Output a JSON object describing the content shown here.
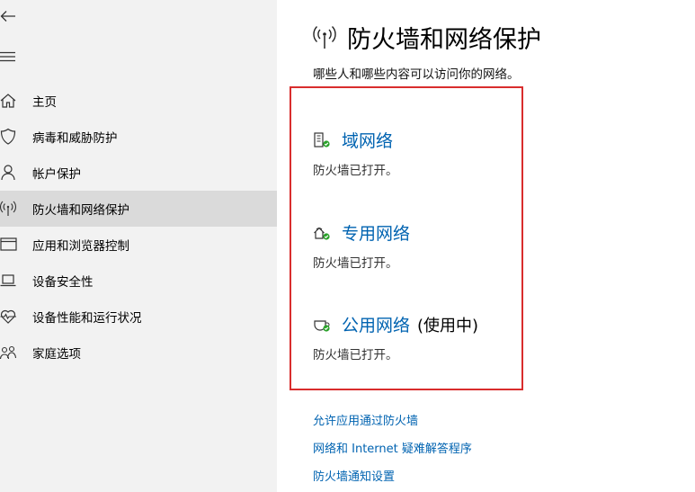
{
  "sidebar": {
    "items": [
      {
        "label": "主页",
        "icon": "home-icon"
      },
      {
        "label": "病毒和威胁防护",
        "icon": "shield-icon"
      },
      {
        "label": "帐户保护",
        "icon": "person-icon"
      },
      {
        "label": "防火墙和网络保护",
        "icon": "wifi-signal-icon",
        "selected": true
      },
      {
        "label": "应用和浏览器控制",
        "icon": "browser-window-icon"
      },
      {
        "label": "设备安全性",
        "icon": "laptop-icon"
      },
      {
        "label": "设备性能和运行状况",
        "icon": "heart-pulse-icon"
      },
      {
        "label": "家庭选项",
        "icon": "family-icon"
      }
    ]
  },
  "main": {
    "title": "防火墙和网络保护",
    "description": "哪些人和哪些内容可以访问你的网络。",
    "networks": [
      {
        "name": "域网络",
        "status": "防火墙已打开。",
        "active": "",
        "icon": "domain-network-icon"
      },
      {
        "name": "专用网络",
        "status": "防火墙已打开。",
        "active": "",
        "icon": "private-network-icon"
      },
      {
        "name": "公用网络",
        "status": "防火墙已打开。",
        "active": "(使用中)",
        "icon": "public-network-icon"
      }
    ],
    "links": [
      "允许应用通过防火墙",
      "网络和 Internet 疑难解答程序",
      "防火墙通知设置"
    ]
  },
  "colors": {
    "accent": "#0063b1",
    "highlight_border": "#d92d2d",
    "status_ok": "#2aa22a",
    "sidebar_bg": "#f2f2f2",
    "sidebar_selected": "#dadada"
  }
}
